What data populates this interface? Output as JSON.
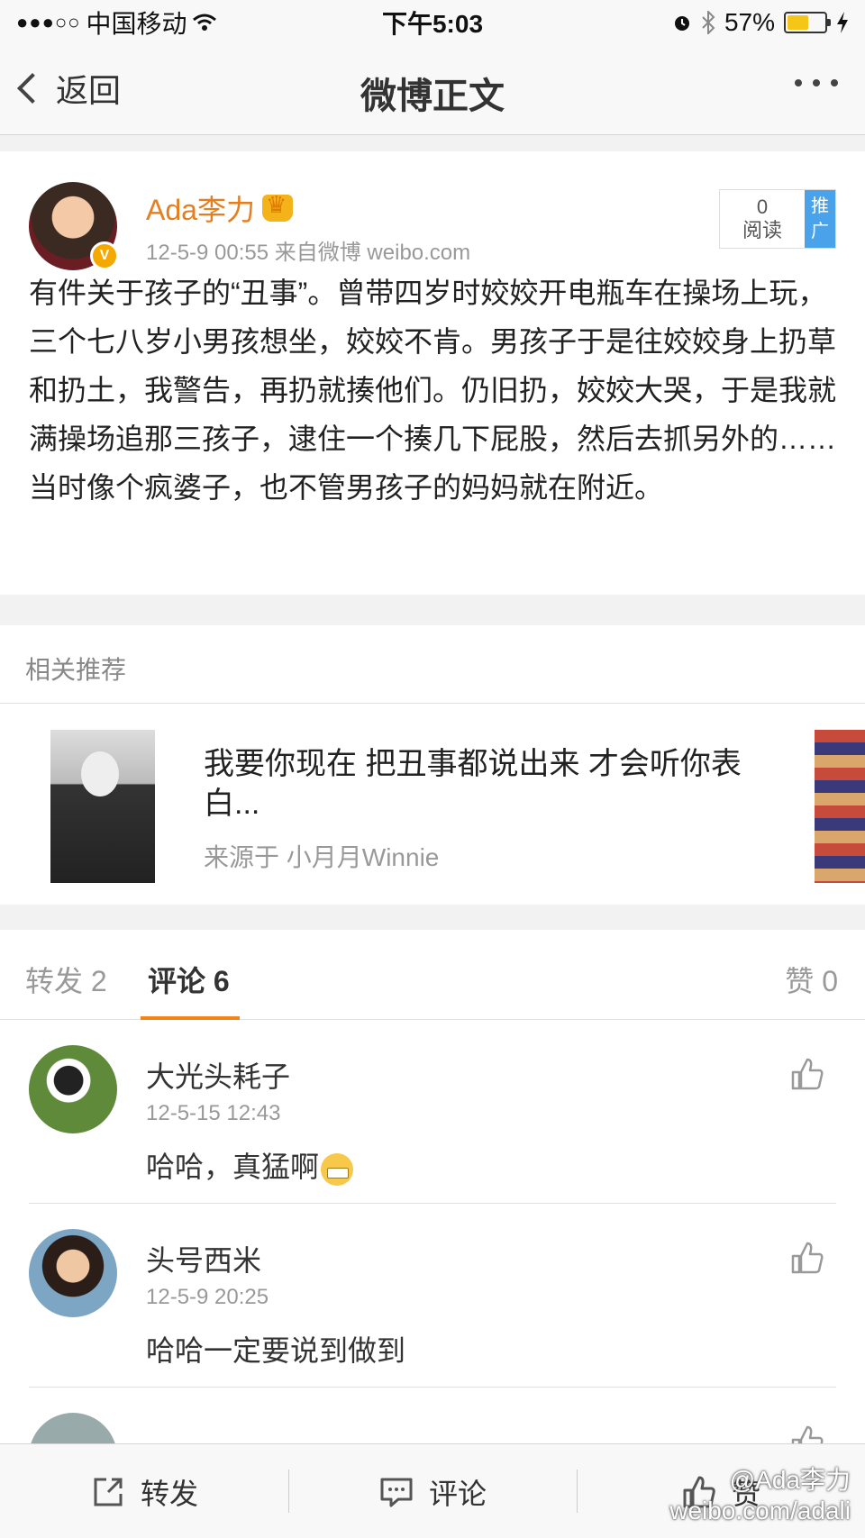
{
  "status_bar": {
    "signal": "●●●○○",
    "carrier": "中国移动",
    "time": "下午5:03",
    "battery_percent": "57%",
    "battery_level": 0.57,
    "battery_color": "#f5c518"
  },
  "nav": {
    "back_label": "返回",
    "title": "微博正文",
    "more_icon": "more-dots-icon"
  },
  "post": {
    "author": "Ada李力",
    "verified_badge": "V",
    "meta": "12-5-9 00:55  来自微博 weibo.com",
    "read_count": "0",
    "read_label": "阅读",
    "promo_label": "推广",
    "text": "有件关于孩子的“丑事”。曾带四岁时姣姣开电瓶车在操场上玩，三个七八岁小男孩想坐，姣姣不肯。男孩子于是往姣姣身上扔草和扔土，我警告，再扔就揍他们。仍旧扔，姣姣大哭，于是我就满操场追那三孩子，逮住一个揍几下屁股，然后去抓另外的…… 当时像个疯婆子，也不管男孩子的妈妈就在附近。"
  },
  "related": {
    "section_title": "相关推荐",
    "headline": "我要你现在 把丑事都说出来 才会听你表白...",
    "source": "来源于 小月月Winnie"
  },
  "tabs": {
    "repost": "转发 2",
    "comment": "评论 6",
    "like": "赞 0",
    "active_color": "#f08418"
  },
  "comments": [
    {
      "name": "大光头耗子",
      "time": "12-5-15 12:43",
      "text": "哈哈，真猛啊"
    },
    {
      "name": "头号西米",
      "time": "12-5-9 20:25",
      "text": "哈哈一定要说到做到"
    }
  ],
  "toolbar": {
    "repost": "转发",
    "comment": "评论",
    "like": "赞"
  },
  "watermark": {
    "line1": "@Ada李力",
    "line2": "weibo.com/adali"
  }
}
